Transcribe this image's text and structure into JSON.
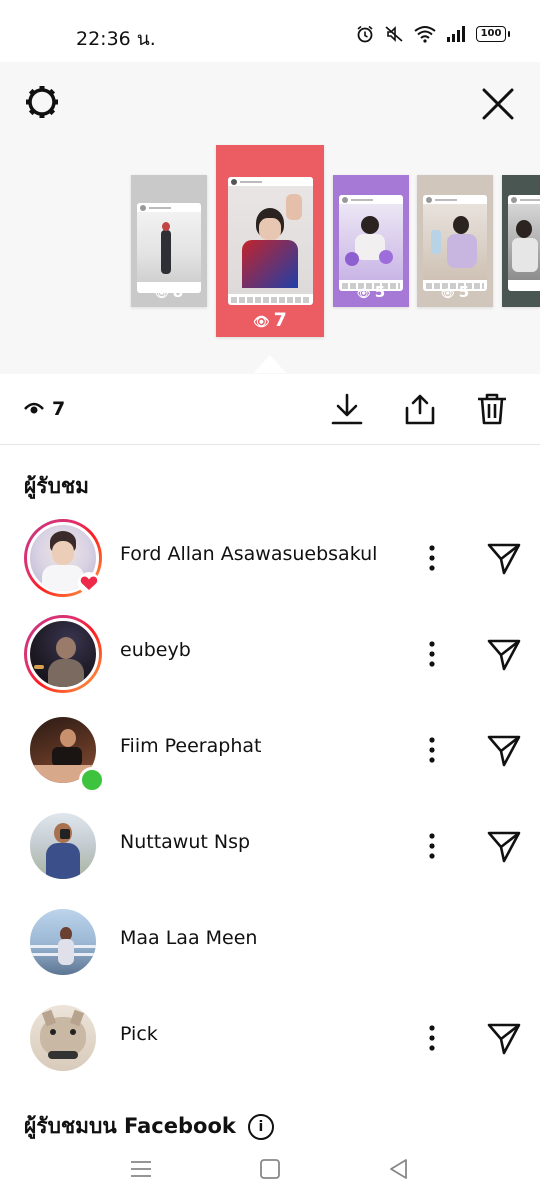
{
  "status_bar": {
    "time": "22:36 น.",
    "battery": "100",
    "icons": [
      "alarm-icon",
      "mute-icon",
      "wifi-icon",
      "signal-icon",
      "battery-icon"
    ]
  },
  "story_strip": {
    "thumbnails": [
      {
        "views": "8",
        "bg": "#c9c9c9"
      },
      {
        "views": "7",
        "bg": "#ec5c63",
        "selected": true
      },
      {
        "views": "5",
        "bg": "#a779d6"
      },
      {
        "views": "5",
        "bg": "#d1c6bb"
      },
      {
        "views": "",
        "bg": "#4a5651"
      }
    ]
  },
  "action_bar": {
    "view_count": "7",
    "icons": [
      "download-icon",
      "share-icon",
      "trash-icon"
    ]
  },
  "viewers_section": {
    "title": "ผู้รับชม",
    "viewers": [
      {
        "name": "Ford Allan Asawasuebsakul",
        "ring": true,
        "badge": "heart",
        "has_actions": true,
        "avatar_colors": [
          "#d8d2e4",
          "#3a2a2a"
        ]
      },
      {
        "name": "eubeyb",
        "ring": true,
        "badge": "",
        "has_actions": true,
        "avatar_colors": [
          "#1d1a24",
          "#7a6a60"
        ]
      },
      {
        "name": "Fiim Peeraphat",
        "ring": false,
        "badge": "online",
        "has_actions": true,
        "avatar_colors": [
          "#2b1a14",
          "#8a5238"
        ]
      },
      {
        "name": "Nuttawut Nsp",
        "ring": false,
        "badge": "",
        "has_actions": true,
        "avatar_colors": [
          "#c6cdd3",
          "#3b4f8a"
        ]
      },
      {
        "name": "Maa Laa Meen",
        "ring": false,
        "badge": "",
        "has_actions": false,
        "avatar_colors": [
          "#bcd4ec",
          "#4a6080"
        ]
      },
      {
        "name": "Pick",
        "ring": false,
        "badge": "",
        "has_actions": true,
        "avatar_colors": [
          "#e8ddd0",
          "#a8927c"
        ]
      }
    ]
  },
  "facebook_section": {
    "title": "ผู้รับชมบน Facebook",
    "info_icon": "i"
  },
  "nav_bar": {
    "icons": [
      "menu-icon",
      "home-icon",
      "back-icon"
    ]
  }
}
